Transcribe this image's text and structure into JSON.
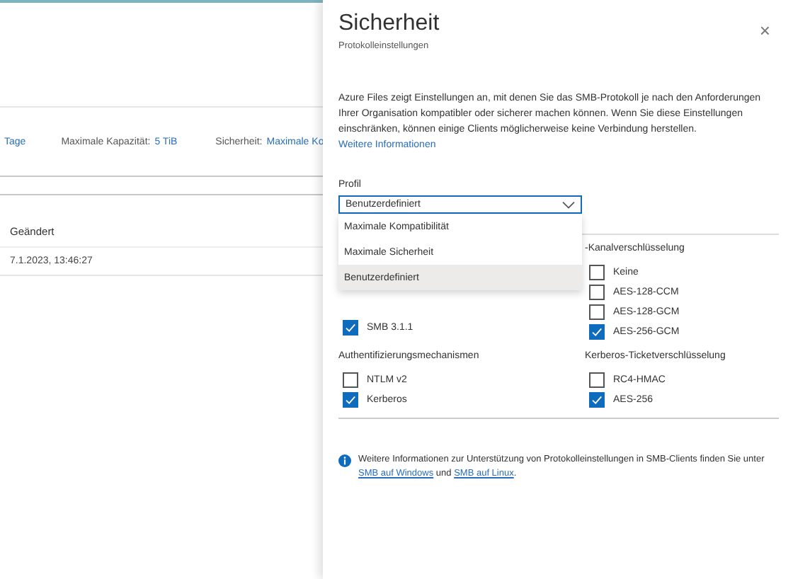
{
  "page": {
    "properties": [
      {
        "value": "Tage"
      },
      {
        "label": "Maximale Kapazität:",
        "value": "5 TiB"
      },
      {
        "label": "Sicherheit:",
        "value": "Maximale Ko"
      }
    ],
    "table": {
      "columns": [
        "Geändert"
      ],
      "rows": [
        [
          "7.1.2023, 13:46:27"
        ]
      ]
    }
  },
  "panel": {
    "title": "Sicherheit",
    "subtitle": "Protokolleinstellungen",
    "close": "×",
    "description": "Azure Files zeigt Einstellungen an, mit denen Sie das SMB-Protokoll je nach den Anforderungen Ihrer Organisation kompatibler oder sicherer machen können. Wenn Sie diese Einstellungen einschränken, können einige Clients möglicherweise keine Verbindung herstellen.",
    "more_link": "Weitere Informationen",
    "profile": {
      "label": "Profil",
      "value": "Benutzerdefiniert",
      "expanded": true,
      "options": [
        {
          "label": "Maximale Kompatibilität",
          "selected": false
        },
        {
          "label": "Maximale Sicherheit",
          "selected": false
        },
        {
          "label": "Benutzerdefiniert",
          "selected": true
        }
      ]
    },
    "groups": [
      {
        "items": [
          {
            "label": "SMB 3.1.1",
            "checked": true
          }
        ]
      },
      {
        "title": "-Kanalverschlüsselung",
        "items": [
          {
            "label": "Keine",
            "checked": false
          },
          {
            "label": "AES-128-CCM",
            "checked": false
          },
          {
            "label": "AES-128-GCM",
            "checked": false
          },
          {
            "label": "AES-256-GCM",
            "checked": true
          }
        ]
      },
      {
        "title": "Authentifizierungsmechanismen",
        "items": [
          {
            "label": "NTLM v2",
            "checked": false
          },
          {
            "label": "Kerberos",
            "checked": true
          }
        ]
      },
      {
        "title": "Kerberos-Ticketverschlüsselung",
        "items": [
          {
            "label": "RC4-HMAC",
            "checked": false
          },
          {
            "label": "AES-256",
            "checked": true
          }
        ]
      }
    ],
    "info": {
      "text": "Weitere Informationen zur Unterstützung von Protokolleinstellungen in SMB-Clients finden Sie unter",
      "link1": "SMB auf Windows",
      "middle": "und",
      "link2": "SMB auf Linux",
      "end": "."
    }
  }
}
